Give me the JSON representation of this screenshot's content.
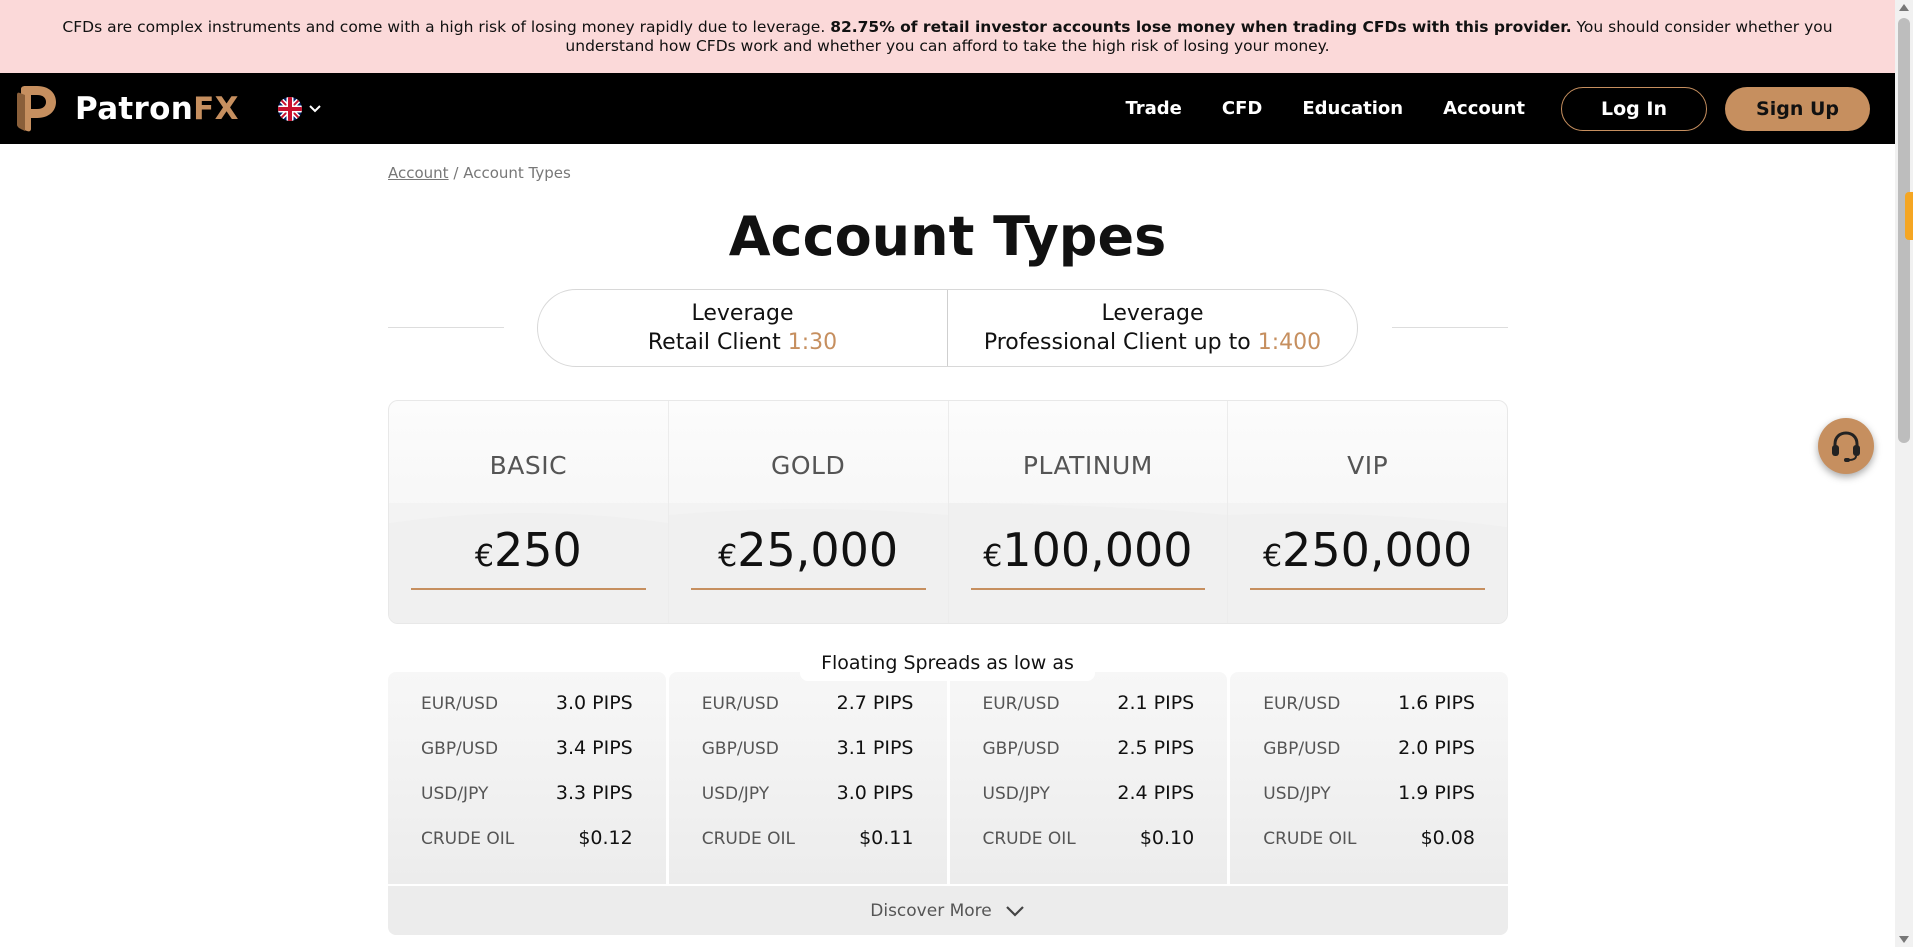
{
  "risk_banner": {
    "text_before": "CFDs are complex instruments and come with a high risk of losing money rapidly due to leverage.",
    "text_bold": "82.75% of retail investor accounts lose money when trading CFDs with this provider.",
    "text_after": "You should consider whether you understand how CFDs work and whether you can afford to take the high risk of losing your money."
  },
  "header": {
    "logo_name": "Patron",
    "logo_suffix": "FX",
    "language_flag": "uk-flag-icon",
    "nav": [
      "Trade",
      "CFD",
      "Education",
      "Account"
    ],
    "login_label": "Log In",
    "signup_label": "Sign Up"
  },
  "breadcrumb": {
    "parent": "Account",
    "separator": "/",
    "current": "Account Types"
  },
  "page_title": "Account Types",
  "leverage": [
    {
      "title": "Leverage",
      "label": "Retail Client",
      "value": "1:30"
    },
    {
      "title": "Leverage",
      "label": "Professional Client up to",
      "value": "1:400"
    }
  ],
  "accounts": [
    {
      "name": "BASIC",
      "currency": "€",
      "amount": "250"
    },
    {
      "name": "GOLD",
      "currency": "€",
      "amount": "25,000"
    },
    {
      "name": "PLATINUM",
      "currency": "€",
      "amount": "100,000"
    },
    {
      "name": "VIP",
      "currency": "€",
      "amount": "250,000"
    }
  ],
  "spreads_label": "Floating Spreads as low as",
  "spreads": [
    [
      {
        "pair": "EUR/USD",
        "value": "3.0 PIPS"
      },
      {
        "pair": "GBP/USD",
        "value": "3.4 PIPS"
      },
      {
        "pair": "USD/JPY",
        "value": "3.3 PIPS"
      },
      {
        "pair": "CRUDE OIL",
        "value": "$0.12"
      }
    ],
    [
      {
        "pair": "EUR/USD",
        "value": "2.7 PIPS"
      },
      {
        "pair": "GBP/USD",
        "value": "3.1 PIPS"
      },
      {
        "pair": "USD/JPY",
        "value": "3.0 PIPS"
      },
      {
        "pair": "CRUDE OIL",
        "value": "$0.11"
      }
    ],
    [
      {
        "pair": "EUR/USD",
        "value": "2.1 PIPS"
      },
      {
        "pair": "GBP/USD",
        "value": "2.5 PIPS"
      },
      {
        "pair": "USD/JPY",
        "value": "2.4 PIPS"
      },
      {
        "pair": "CRUDE OIL",
        "value": "$0.10"
      }
    ],
    [
      {
        "pair": "EUR/USD",
        "value": "1.6 PIPS"
      },
      {
        "pair": "GBP/USD",
        "value": "2.0 PIPS"
      },
      {
        "pair": "USD/JPY",
        "value": "1.9 PIPS"
      },
      {
        "pair": "CRUDE OIL",
        "value": "$0.08"
      }
    ]
  ],
  "discover_more": "Discover More",
  "colors": {
    "accent": "#c68f5f",
    "banner_bg": "#fbd9d9",
    "nav_bg": "#000000"
  },
  "icons": {
    "support": "headset-icon",
    "discover": "chevron-down-icon"
  }
}
